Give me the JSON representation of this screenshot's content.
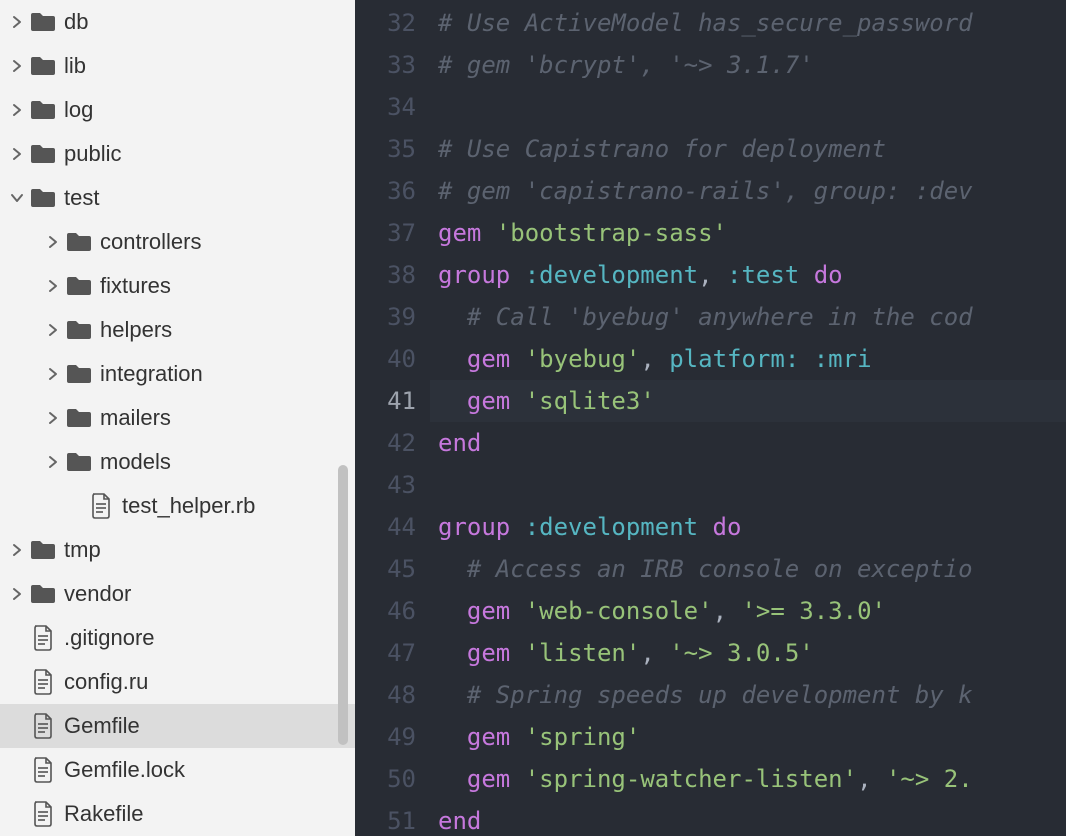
{
  "sidebar": {
    "items": [
      {
        "name": "db",
        "type": "folder",
        "indent": 0,
        "chev": "right"
      },
      {
        "name": "lib",
        "type": "folder",
        "indent": 0,
        "chev": "right"
      },
      {
        "name": "log",
        "type": "folder",
        "indent": 0,
        "chev": "right"
      },
      {
        "name": "public",
        "type": "folder",
        "indent": 0,
        "chev": "right"
      },
      {
        "name": "test",
        "type": "folder",
        "indent": 0,
        "chev": "down"
      },
      {
        "name": "controllers",
        "type": "folder",
        "indent": 1,
        "chev": "right"
      },
      {
        "name": "fixtures",
        "type": "folder",
        "indent": 1,
        "chev": "right"
      },
      {
        "name": "helpers",
        "type": "folder",
        "indent": 1,
        "chev": "right"
      },
      {
        "name": "integration",
        "type": "folder",
        "indent": 1,
        "chev": "right"
      },
      {
        "name": "mailers",
        "type": "folder",
        "indent": 1,
        "chev": "right"
      },
      {
        "name": "models",
        "type": "folder",
        "indent": 1,
        "chev": "right"
      },
      {
        "name": "test_helper.rb",
        "type": "file",
        "indent": 2,
        "chev": "none"
      },
      {
        "name": "tmp",
        "type": "folder",
        "indent": 0,
        "chev": "right"
      },
      {
        "name": "vendor",
        "type": "folder",
        "indent": 0,
        "chev": "right"
      },
      {
        "name": ".gitignore",
        "type": "file",
        "indent": 0,
        "chev": "none",
        "pad": true
      },
      {
        "name": "config.ru",
        "type": "file",
        "indent": 0,
        "chev": "none",
        "pad": true
      },
      {
        "name": "Gemfile",
        "type": "file",
        "indent": 0,
        "chev": "none",
        "pad": true,
        "active": true
      },
      {
        "name": "Gemfile.lock",
        "type": "file",
        "indent": 0,
        "chev": "none",
        "pad": true
      },
      {
        "name": "Rakefile",
        "type": "file",
        "indent": 0,
        "chev": "none",
        "pad": true
      }
    ]
  },
  "editor": {
    "current_line": 41,
    "lines": [
      {
        "n": 32,
        "tokens": [
          {
            "cls": "c",
            "t": "# Use ActiveModel has_secure_password"
          }
        ]
      },
      {
        "n": 33,
        "tokens": [
          {
            "cls": "c",
            "t": "# gem 'bcrypt', '~> 3.1.7'"
          }
        ]
      },
      {
        "n": 34,
        "tokens": []
      },
      {
        "n": 35,
        "tokens": [
          {
            "cls": "c",
            "t": "# Use Capistrano for deployment"
          }
        ]
      },
      {
        "n": 36,
        "tokens": [
          {
            "cls": "c",
            "t": "# gem 'capistrano-rails', group: :dev"
          }
        ]
      },
      {
        "n": 37,
        "tokens": [
          {
            "cls": "k",
            "t": "gem"
          },
          {
            "cls": "p",
            "t": " "
          },
          {
            "cls": "s",
            "t": "'bootstrap-sass'"
          }
        ]
      },
      {
        "n": 38,
        "tokens": [
          {
            "cls": "k",
            "t": "group"
          },
          {
            "cls": "p",
            "t": " "
          },
          {
            "cls": "sy",
            "t": ":development"
          },
          {
            "cls": "p",
            "t": ", "
          },
          {
            "cls": "sy",
            "t": ":test"
          },
          {
            "cls": "p",
            "t": " "
          },
          {
            "cls": "k",
            "t": "do"
          }
        ]
      },
      {
        "n": 39,
        "tokens": [
          {
            "cls": "p",
            "t": "  "
          },
          {
            "cls": "c",
            "t": "# Call 'byebug' anywhere in the cod"
          }
        ]
      },
      {
        "n": 40,
        "tokens": [
          {
            "cls": "p",
            "t": "  "
          },
          {
            "cls": "k",
            "t": "gem"
          },
          {
            "cls": "p",
            "t": " "
          },
          {
            "cls": "s",
            "t": "'byebug'"
          },
          {
            "cls": "p",
            "t": ", "
          },
          {
            "cls": "sy",
            "t": "platform:"
          },
          {
            "cls": "p",
            "t": " "
          },
          {
            "cls": "sy",
            "t": ":mri"
          }
        ]
      },
      {
        "n": 41,
        "tokens": [
          {
            "cls": "p",
            "t": "  "
          },
          {
            "cls": "k",
            "t": "gem"
          },
          {
            "cls": "p",
            "t": " "
          },
          {
            "cls": "s",
            "t": "'sqlite3'"
          }
        ]
      },
      {
        "n": 42,
        "tokens": [
          {
            "cls": "k",
            "t": "end"
          }
        ]
      },
      {
        "n": 43,
        "tokens": []
      },
      {
        "n": 44,
        "tokens": [
          {
            "cls": "k",
            "t": "group"
          },
          {
            "cls": "p",
            "t": " "
          },
          {
            "cls": "sy",
            "t": ":development"
          },
          {
            "cls": "p",
            "t": " "
          },
          {
            "cls": "k",
            "t": "do"
          }
        ]
      },
      {
        "n": 45,
        "tokens": [
          {
            "cls": "p",
            "t": "  "
          },
          {
            "cls": "c",
            "t": "# Access an IRB console on exceptio"
          }
        ]
      },
      {
        "n": 46,
        "tokens": [
          {
            "cls": "p",
            "t": "  "
          },
          {
            "cls": "k",
            "t": "gem"
          },
          {
            "cls": "p",
            "t": " "
          },
          {
            "cls": "s",
            "t": "'web-console'"
          },
          {
            "cls": "p",
            "t": ", "
          },
          {
            "cls": "s",
            "t": "'>= 3.3.0'"
          }
        ]
      },
      {
        "n": 47,
        "tokens": [
          {
            "cls": "p",
            "t": "  "
          },
          {
            "cls": "k",
            "t": "gem"
          },
          {
            "cls": "p",
            "t": " "
          },
          {
            "cls": "s",
            "t": "'listen'"
          },
          {
            "cls": "p",
            "t": ", "
          },
          {
            "cls": "s",
            "t": "'~> 3.0.5'"
          }
        ]
      },
      {
        "n": 48,
        "tokens": [
          {
            "cls": "p",
            "t": "  "
          },
          {
            "cls": "c",
            "t": "# Spring speeds up development by k"
          }
        ]
      },
      {
        "n": 49,
        "tokens": [
          {
            "cls": "p",
            "t": "  "
          },
          {
            "cls": "k",
            "t": "gem"
          },
          {
            "cls": "p",
            "t": " "
          },
          {
            "cls": "s",
            "t": "'spring'"
          }
        ]
      },
      {
        "n": 50,
        "tokens": [
          {
            "cls": "p",
            "t": "  "
          },
          {
            "cls": "k",
            "t": "gem"
          },
          {
            "cls": "p",
            "t": " "
          },
          {
            "cls": "s",
            "t": "'spring-watcher-listen'"
          },
          {
            "cls": "p",
            "t": ", "
          },
          {
            "cls": "s",
            "t": "'~> 2."
          }
        ]
      },
      {
        "n": 51,
        "tokens": [
          {
            "cls": "k",
            "t": "end"
          }
        ]
      }
    ]
  }
}
